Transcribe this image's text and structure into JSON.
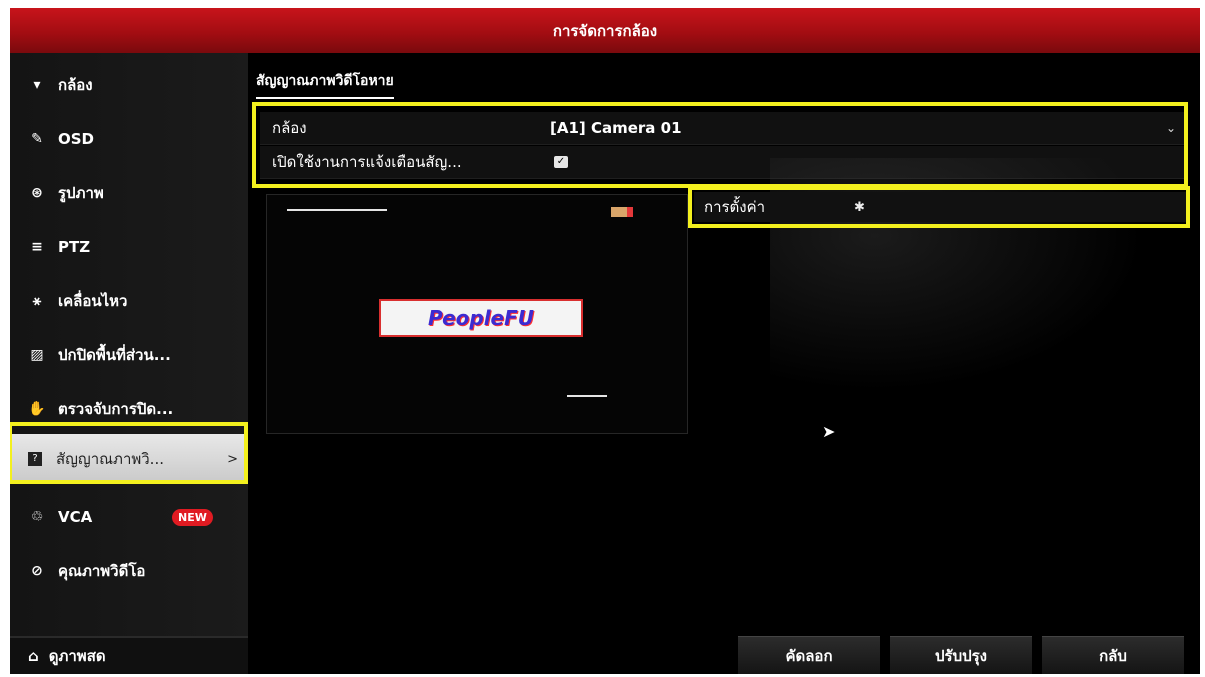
{
  "window": {
    "title": "การจัดการกล้อง"
  },
  "sidebar": {
    "items": [
      {
        "label": "กล้อง",
        "icon": "camera-icon"
      },
      {
        "label": "OSD",
        "icon": "pen-icon"
      },
      {
        "label": "รูปภาพ",
        "icon": "palette-icon"
      },
      {
        "label": "PTZ",
        "icon": "ptz-icon"
      },
      {
        "label": "เคลื่อนไหว",
        "icon": "running-person-icon"
      },
      {
        "label": "ปกปิดพื้นที่ส่วน...",
        "icon": "privacy-mask-icon"
      },
      {
        "label": "ตรวจจับการปิด...",
        "icon": "hand-icon"
      },
      {
        "label": "สัญญาณภาพวิ...",
        "icon": "question-icon",
        "chevron": ">"
      },
      {
        "label": "VCA",
        "icon": "vca-icon",
        "badge": "NEW"
      },
      {
        "label": "คุณภาพวิดีโอ",
        "icon": "quality-icon"
      }
    ],
    "bottom": {
      "label": "ดูภาพสด",
      "icon": "home-icon"
    }
  },
  "tab": {
    "label": "สัญญาณภาพวิดีโอหาย"
  },
  "form": {
    "camera_label": "กล้อง",
    "camera_value": "[A1] Camera 01",
    "alarm_label": "เปิดใช้งานการแจ้งเตือนสัญ...",
    "alarm_checked": true,
    "settings_label": "การตั้งค่า"
  },
  "preview": {
    "logo_text": "PeopleFU"
  },
  "buttons": {
    "copy": "คัดลอก",
    "apply": "ปรับปรุง",
    "back": "กลับ"
  },
  "colors": {
    "title_bar": "#b5121a",
    "highlight": "#f3f01e",
    "badge": "#e01b22"
  }
}
